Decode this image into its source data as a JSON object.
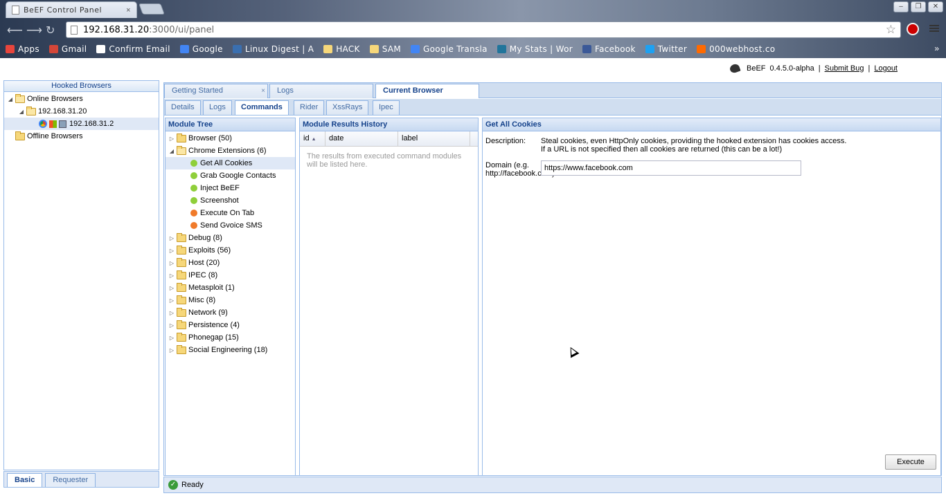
{
  "browser": {
    "tab_title": "BeEF Control Panel",
    "tab_close": "×",
    "url_host": "192.168.31.20",
    "url_path": ":3000/ui/panel",
    "window_controls": {
      "minimize": "–",
      "restore": "❐",
      "close": "✕"
    },
    "bookmarks": [
      {
        "label": "Apps",
        "color": "#e8453c"
      },
      {
        "label": "Gmail",
        "color": "#d44638"
      },
      {
        "label": "Confirm Email",
        "color": "#ffffff"
      },
      {
        "label": "Google",
        "color": "#4285f4"
      },
      {
        "label": "Linux Digest | A",
        "color": "#3a6fb0"
      },
      {
        "label": "HACK",
        "color": "#f6d77a"
      },
      {
        "label": "SAM",
        "color": "#f6d77a"
      },
      {
        "label": "Google Transla",
        "color": "#4285f4"
      },
      {
        "label": "My Stats | Wor",
        "color": "#21759b"
      },
      {
        "label": "Facebook",
        "color": "#3b5998"
      },
      {
        "label": "Twitter",
        "color": "#1da1f2"
      },
      {
        "label": "000webhost.co",
        "color": "#ff6a00"
      }
    ],
    "more_bookmarks": "»"
  },
  "header": {
    "product": "BeEF",
    "version": "0.4.5.0-alpha",
    "sep": "|",
    "submit_bug": "Submit Bug",
    "logout": "Logout"
  },
  "hooked": {
    "title": "Hooked Browsers",
    "online": "Online Browsers",
    "online_host": "192.168.31.20",
    "online_client": "192.168.31.2",
    "offline": "Offline Browsers"
  },
  "west_tabs": {
    "basic": "Basic",
    "requester": "Requester"
  },
  "main_tabs": {
    "getting_started": "Getting Started",
    "close": "×",
    "logs": "Logs",
    "current_browser": "Current Browser"
  },
  "sub_tabs": [
    "Details",
    "Logs",
    "Commands",
    "Rider",
    "XssRays",
    "Ipec"
  ],
  "module_tree": {
    "title": "Module Tree",
    "browser": "Browser (50)",
    "chrome_ext": "Chrome Extensions (6)",
    "chrome_items": [
      {
        "label": "Get All Cookies",
        "status": "#8fcf3a"
      },
      {
        "label": "Grab Google Contacts",
        "status": "#8fcf3a"
      },
      {
        "label": "Inject BeEF",
        "status": "#8fcf3a"
      },
      {
        "label": "Screenshot",
        "status": "#8fcf3a"
      },
      {
        "label": "Execute On Tab",
        "status": "#f07a2a"
      },
      {
        "label": "Send Gvoice SMS",
        "status": "#f07a2a"
      }
    ],
    "categories": [
      "Debug (8)",
      "Exploits (56)",
      "Host (20)",
      "IPEC (8)",
      "Metasploit (1)",
      "Misc (8)",
      "Network (9)",
      "Persistence (4)",
      "Phonegap (15)",
      "Social Engineering (18)"
    ]
  },
  "results": {
    "title": "Module Results History",
    "cols": [
      "id",
      "date",
      "label"
    ],
    "sort_icon": "▲",
    "empty": "The results from executed command modules will be listed here."
  },
  "command": {
    "title": "Get All Cookies",
    "desc_label": "Description:",
    "desc_line1": "Steal cookies, even HttpOnly cookies, providing the hooked extension has cookies access.",
    "desc_line2": "If a URL is not specified then all cookies are returned (this can be a lot!)",
    "domain_label": "Domain (e.g. http://facebook.com):",
    "domain_value": "https://www.facebook.com",
    "execute": "Execute"
  },
  "status": {
    "text": "Ready"
  }
}
